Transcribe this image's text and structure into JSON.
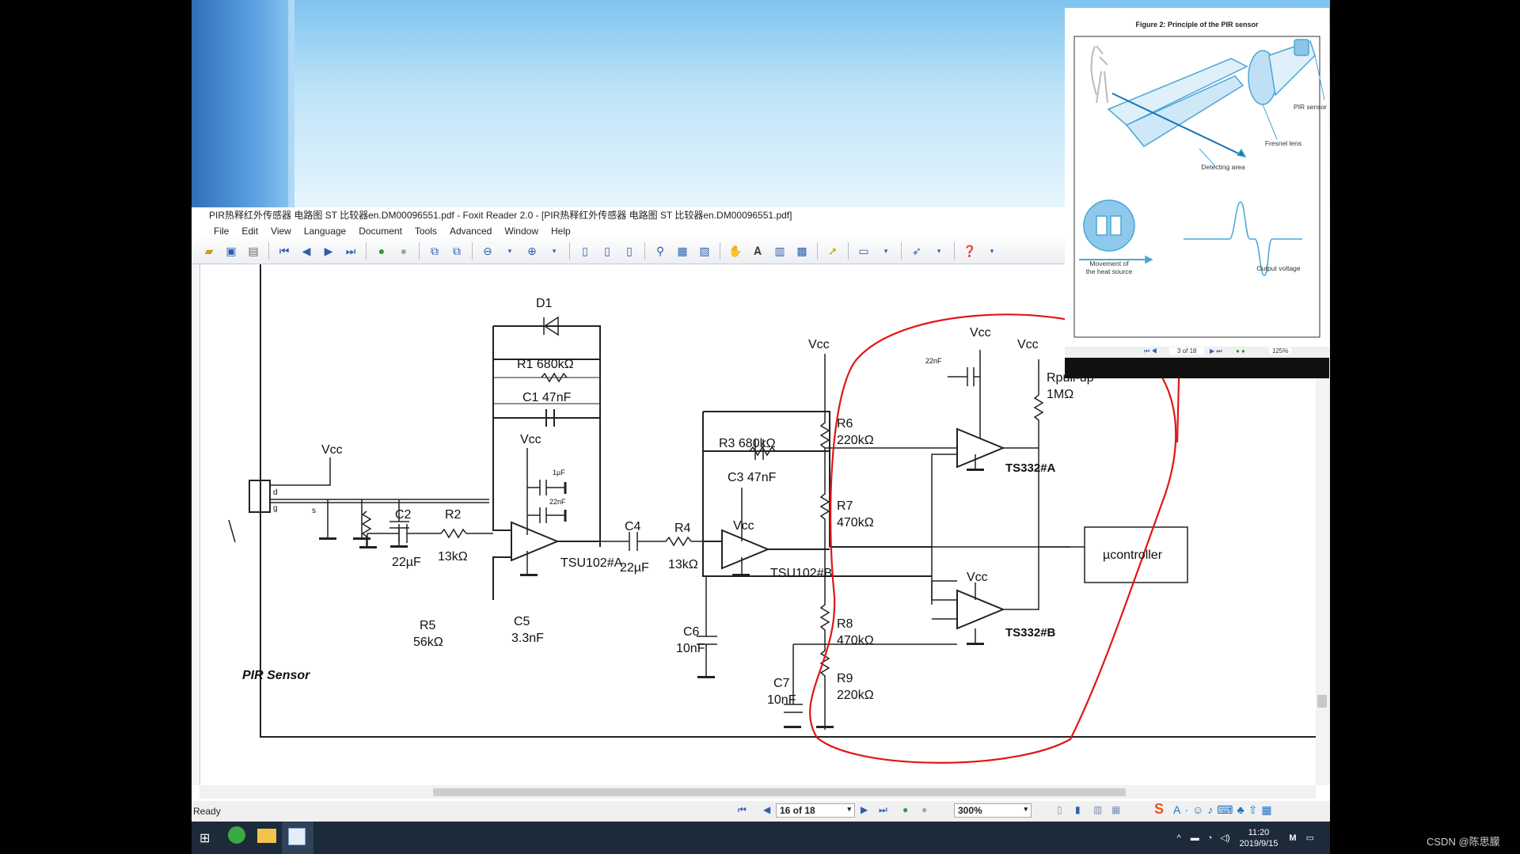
{
  "window": {
    "title": "PIR热释红外传感器 电路图 ST 比较器en.DM00096551.pdf - Foxit Reader 2.0 - [PIR热释红外传感器 电路图 ST 比较器en.DM00096551.pdf]"
  },
  "menu": [
    "File",
    "Edit",
    "View",
    "Language",
    "Document",
    "Tools",
    "Advanced",
    "Window",
    "Help"
  ],
  "status": {
    "ready": "Ready",
    "page": "16 of 18",
    "zoom": "300%"
  },
  "clock": {
    "time": "11:20",
    "date": "2019/9/15"
  },
  "watermark": "CSDN @陈思朦",
  "inset": {
    "title": "Figure 2: Principle of the PIR sensor",
    "labels": {
      "pir": "PIR sensor",
      "fresnel": "Fresnel lens",
      "detect": "Detecting area",
      "movement1": "Movement of",
      "movement2": "the heat source",
      "output": "Output voltage"
    },
    "nav": {
      "page": "3 of 18",
      "zoom": "125%"
    }
  },
  "schematic": {
    "D1": "D1",
    "R1": "R1  680kΩ",
    "C1": "C1  47nF",
    "R3": "R3  680kΩ",
    "C3": "C3  47nF",
    "C2": "C2",
    "C2v": "22µF",
    "R2": "R2",
    "R2v": "13kΩ",
    "C4": "C4",
    "C4v": "22µF",
    "R4": "R4",
    "R4v": "13kΩ",
    "R5": "R5",
    "R5v": "56kΩ",
    "C5": "C5",
    "C5v": "3.3nF",
    "C6": "C6",
    "C6v": "10nF",
    "C7": "C7",
    "C7v": "10nF",
    "R6": "R6",
    "R6v": "220kΩ",
    "R7": "R7",
    "R7v": "470kΩ",
    "R8": "R8",
    "R8v": "470kΩ",
    "R9": "R9",
    "R9v": "220kΩ",
    "Rpull": "Rpull-up",
    "Rpullv": "1MΩ",
    "u1a": "TSU102#A",
    "u1b": "TSU102#B",
    "u2a": "TS332#A",
    "u2b": "TS332#B",
    "vcc": "Vcc",
    "cap1u": "1µF",
    "cap22n": "22nF",
    "cap22n2": "22nF",
    "pin_d": "d",
    "pin_s": "s",
    "pin_g": "g",
    "pir": "PIR Sensor",
    "mcu": "µcontroller"
  }
}
